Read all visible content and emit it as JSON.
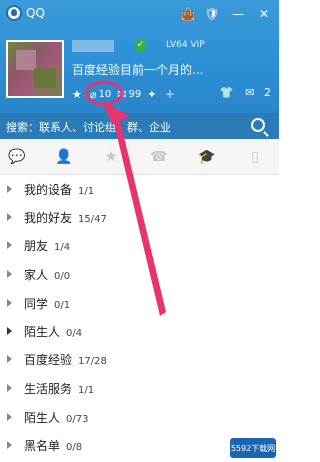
{
  "titlebar": {
    "app_name": "QQ"
  },
  "profile": {
    "level_text": "LV64 VIP",
    "signature": "百度经验目前一个月的..."
  },
  "status": {
    "items": [
      {
        "icon": "star-icon",
        "value": ""
      },
      {
        "icon": "qzone-icon",
        "value": "10"
      },
      {
        "icon": "mail-icon",
        "value": "99"
      },
      {
        "icon": "game-icon",
        "value": ""
      },
      {
        "icon": "plus-icon",
        "value": ""
      }
    ],
    "right": [
      {
        "icon": "shirt-icon",
        "value": ""
      },
      {
        "icon": "messages-icon",
        "value": "2"
      }
    ]
  },
  "search": {
    "label": "搜索：联系人、讨论组、群、企业"
  },
  "tabs": [
    {
      "name": "tab-messages",
      "icon": "chat-icon",
      "active": false
    },
    {
      "name": "tab-contacts",
      "icon": "person-icon",
      "active": true
    },
    {
      "name": "tab-favorites",
      "icon": "star-icon",
      "active": false
    },
    {
      "name": "tab-calls",
      "icon": "phone-icon",
      "active": false
    },
    {
      "name": "tab-education",
      "icon": "cap-icon",
      "active": false
    },
    {
      "name": "tab-mobile",
      "icon": "mobile-icon",
      "active": false
    }
  ],
  "groups": [
    {
      "name": "我的设备",
      "count": "1/1",
      "expanded": false
    },
    {
      "name": "我的好友",
      "count": "15/47",
      "expanded": false
    },
    {
      "name": "朋友",
      "count": "1/4",
      "expanded": false
    },
    {
      "name": "家人",
      "count": "0/0",
      "expanded": false
    },
    {
      "name": "同学",
      "count": "0/1",
      "expanded": false
    },
    {
      "name": "陌生人",
      "count": "0/4",
      "expanded": false
    },
    {
      "name": "百度经验",
      "count": "17/28",
      "expanded": false
    },
    {
      "name": "生活服务",
      "count": "1/1",
      "expanded": false
    },
    {
      "name": "陌生人",
      "count": "0/73",
      "expanded": false
    },
    {
      "name": "黑名单",
      "count": "0/8",
      "expanded": false
    }
  ],
  "watermark": {
    "text": "5592下载网"
  },
  "colors": {
    "header": "#2d8fd5",
    "search_bar": "#2a7bb8",
    "annotation": "#e8336e"
  }
}
